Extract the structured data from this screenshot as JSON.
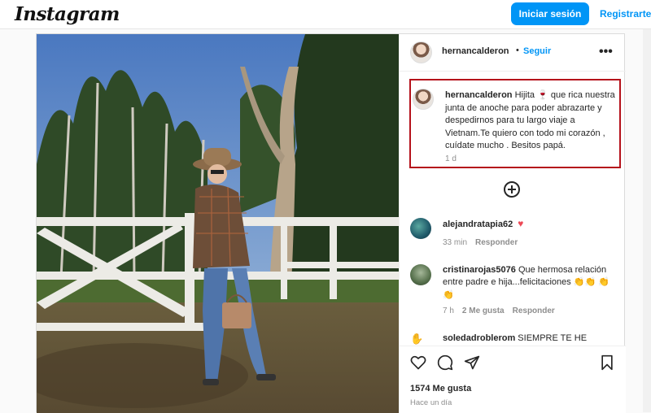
{
  "topbar": {
    "logo": "Instagram",
    "login_label": "Iniciar sesión",
    "register_label": "Registrarte"
  },
  "post": {
    "header": {
      "username": "hernancalderon",
      "dot": "•",
      "follow_label": "Seguir",
      "more_icon": "more-horizontal-icon"
    },
    "caption": {
      "username": "hernancalderon",
      "text": " Hijita 🍷 que rica nuestra junta de anoche para poder abrazarte y despedirnos para tu largo viaje a Vietnam.Te quiero con todo mi corazón , cuídate mucho . Besitos papá.",
      "time": "1 d",
      "highlight_color": "#b5121b"
    },
    "load_more_icon": "plus-circle-icon",
    "comments": [
      {
        "username": "alejandratapia62",
        "text": " ",
        "emoji": "♥",
        "time": "33 min",
        "reply_label": "Responder",
        "likes_label": ""
      },
      {
        "username": "cristinarojas5076",
        "text": " Que hermosa relación entre padre e hija...felicitaciones 👏👏 👏👏",
        "time": "7 h",
        "likes_label": "2 Me gusta",
        "reply_label": "Responder"
      },
      {
        "username": "soledadroblerom",
        "text": " SIEMPRE TE HE"
      }
    ],
    "actions": {
      "like_icon": "heart-icon",
      "comment_icon": "comment-icon",
      "share_icon": "send-icon",
      "save_icon": "bookmark-icon"
    },
    "likes": "1574 Me gusta",
    "posted": "Hace un día"
  },
  "colors": {
    "accent": "#0095f6",
    "text": "#262626",
    "muted": "#8e8e8e",
    "heart": "#ed4956"
  }
}
